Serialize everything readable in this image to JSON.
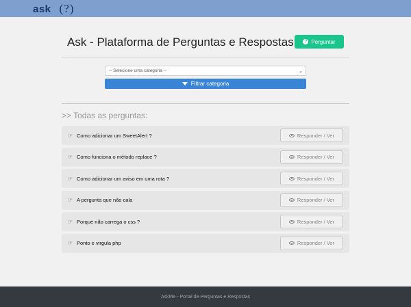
{
  "navbar": {
    "brand_text": "ask",
    "brand_mark": "(?)"
  },
  "header": {
    "title": "Ask - Plataforma de Perguntas e Respostas",
    "ask_button": {
      "label": "Perguntar",
      "icon": "question-circle-icon",
      "color": "#19c58b"
    }
  },
  "filter": {
    "select_value": "-- Selecione uma categoria --",
    "button_label": "Filtrar categoria",
    "button_icon": "filter-icon",
    "button_color": "#3a84d6"
  },
  "questions_section": {
    "title": ">> Todas as perguntas:",
    "items": [
      {
        "text": "Como adicionar um SweetAlert ?",
        "action": "Responder / Ver"
      },
      {
        "text": "Como funciona o método replace ?",
        "action": "Responder / Ver"
      },
      {
        "text": "Como adicionar um aviso em uma rota ?",
        "action": "Responder / Ver"
      },
      {
        "text": "A pergunta que não cala",
        "action": "Responder / Ver"
      },
      {
        "text": "Porque não carrega o css ?",
        "action": "Responder / Ver"
      },
      {
        "text": "Ponto e virgula php",
        "action": "Responder / Ver"
      }
    ]
  },
  "footer": {
    "text": "AskMe - Portal de Perguntas e Respostas"
  }
}
